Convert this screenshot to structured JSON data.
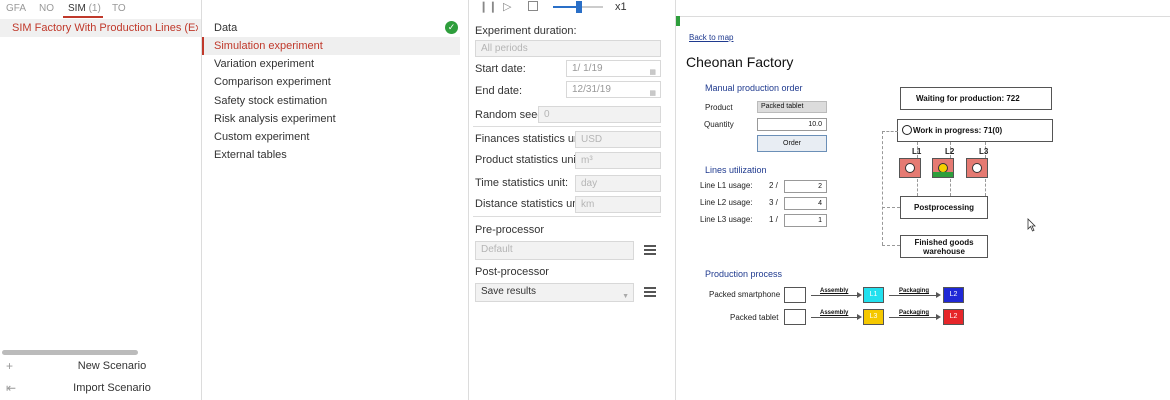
{
  "left": {
    "tabs": [
      {
        "label": "GFA"
      },
      {
        "label": "NO"
      },
      {
        "label": "SIM",
        "count": "(1)"
      },
      {
        "label": "TO"
      }
    ],
    "scenario": "SIM Factory With Production Lines (Externa",
    "actions": {
      "new_scenario": "New Scenario",
      "import_scenario": "Import Scenario"
    }
  },
  "menu": {
    "items": [
      "Data",
      "Simulation experiment",
      "Variation experiment",
      "Comparison experiment",
      "Safety stock estimation",
      "Risk analysis experiment",
      "Custom experiment",
      "External tables"
    ],
    "selected_index": 1
  },
  "toolbar": {
    "speed": "x1"
  },
  "settings": {
    "experiment_duration_label": "Experiment duration:",
    "experiment_duration_value": "All periods",
    "start_date_label": "Start date:",
    "start_date_value": "1/  1/19",
    "end_date_label": "End date:",
    "end_date_value": "12/31/19",
    "random_seed_label": "Random seed:",
    "random_seed_value": "0",
    "finances_unit_label": "Finances statistics unit:",
    "finances_unit_value": "USD",
    "product_unit_label": "Product statistics unit:",
    "product_unit_value": "m³",
    "time_unit_label": "Time statistics unit:",
    "time_unit_value": "day",
    "distance_unit_label": "Distance statistics unit:",
    "distance_unit_value": "km",
    "preprocessor_label": "Pre-processor",
    "preprocessor_value": "Default",
    "postprocessor_label": "Post-processor",
    "postprocessor_value": "Save results"
  },
  "canvas": {
    "back_link": "Back to map",
    "title": "Cheonan Factory",
    "manual_order": {
      "section": "Manual production order",
      "product_label": "Product",
      "product_value": "Packed tablet",
      "quantity_label": "Quantity",
      "quantity_value": "10.0",
      "order_button": "Order"
    },
    "utilization": {
      "section": "Lines utilization",
      "rows": [
        {
          "label": "Line L1 usage:",
          "fraction": "2 /",
          "value": "2"
        },
        {
          "label": "Line L2 usage:",
          "fraction": "3 /",
          "value": "4"
        },
        {
          "label": "Line L3 usage:",
          "fraction": "1 /",
          "value": "1"
        }
      ]
    },
    "status": {
      "waiting": "Waiting for production: 722",
      "wip": "Work in progress: 71(0)",
      "lines": [
        "L1",
        "L2",
        "L3"
      ],
      "postprocessing": "Postprocessing",
      "warehouse_line1": "Finished goods",
      "warehouse_line2": "warehouse"
    },
    "process": {
      "section": "Production process",
      "rows": [
        {
          "product": "Packed smartphone",
          "step1": "Assembly",
          "line1": "L1",
          "step2": "Packaging",
          "line2": "L2",
          "color1": "#22e0ee",
          "color2": "#1f28d6"
        },
        {
          "product": "Packed tablet",
          "step1": "Assembly",
          "line1": "L3",
          "step2": "Packaging",
          "line2": "L2",
          "color1": "#f5c800",
          "color2": "#e6262a"
        }
      ]
    }
  },
  "colors": {
    "accent": "#c0392b",
    "ok_green": "#2e9e3c",
    "line_box": "#e57a72",
    "section_blue": "#1f3a8f"
  }
}
